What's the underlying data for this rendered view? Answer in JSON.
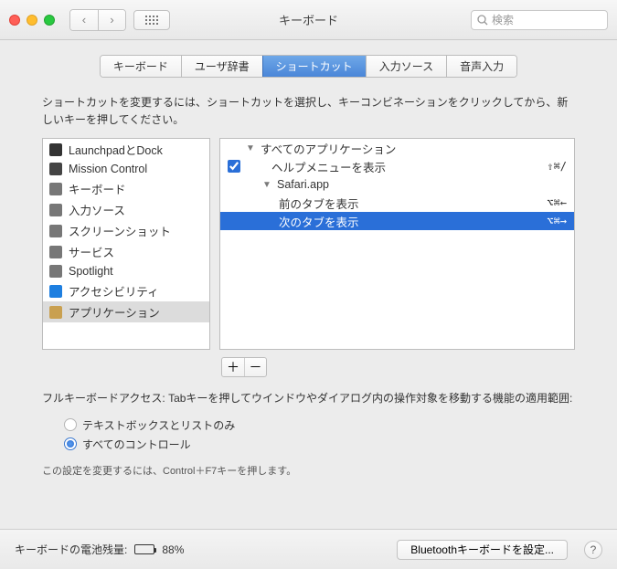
{
  "window": {
    "title": "キーボード"
  },
  "search": {
    "placeholder": "検索"
  },
  "tabs": [
    "キーボード",
    "ユーザ辞書",
    "ショートカット",
    "入力ソース",
    "音声入力"
  ],
  "active_tab": 2,
  "instruction": "ショートカットを変更するには、ショートカットを選択し、キーコンビネーションをクリックしてから、新しいキーを押してください。",
  "categories": [
    {
      "label": "LaunchpadとDock",
      "icon": "launchpad"
    },
    {
      "label": "Mission Control",
      "icon": "mission"
    },
    {
      "label": "キーボード",
      "icon": "keyboard"
    },
    {
      "label": "入力ソース",
      "icon": "input"
    },
    {
      "label": "スクリーンショット",
      "icon": "screenshot"
    },
    {
      "label": "サービス",
      "icon": "services"
    },
    {
      "label": "Spotlight",
      "icon": "spotlight"
    },
    {
      "label": "アクセシビリティ",
      "icon": "accessibility"
    },
    {
      "label": "アプリケーション",
      "icon": "app"
    }
  ],
  "selected_category": 8,
  "shortcuts": {
    "group_all": "すべてのアプリケーション",
    "help_menu": {
      "label": "ヘルプメニューを表示",
      "keys": "⇧⌘/"
    },
    "group_safari": "Safari.app",
    "prev_tab": {
      "label": "前のタブを表示",
      "keys": "⌥⌘←"
    },
    "next_tab": {
      "label": "次のタブを表示",
      "keys": "⌥⌘→"
    }
  },
  "fka": {
    "text": "フルキーボードアクセス: Tabキーを押してウインドウやダイアログ内の操作対象を移動する機能の適用範囲:",
    "opt1": "テキストボックスとリストのみ",
    "opt2": "すべてのコントロール",
    "selected": 1,
    "hint": "この設定を変更するには、Control＋F7キーを押します。"
  },
  "footer": {
    "battery_label": "キーボードの電池残量:",
    "battery_pct": "88%",
    "battery_fill": 88,
    "bt_button": "Bluetoothキーボードを設定..."
  }
}
